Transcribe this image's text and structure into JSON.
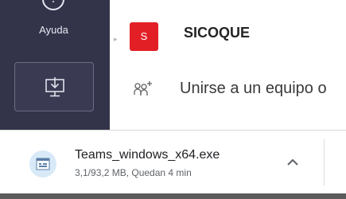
{
  "rail": {
    "help_label": "Ayuda",
    "help_icon": "help-icon",
    "download_icon": "download-desktop-icon"
  },
  "team": {
    "avatar_letter": "S",
    "name": "SICOQUE",
    "avatar_color": "#e31f26"
  },
  "join": {
    "text": "Unirse a un equipo o",
    "icon": "people-add-icon"
  },
  "download": {
    "file_name": "Teams_windows_x64.exe",
    "status": "3,1/93,2 MB, Quedan 4 min",
    "menu_icon": "chevron-up-icon"
  }
}
